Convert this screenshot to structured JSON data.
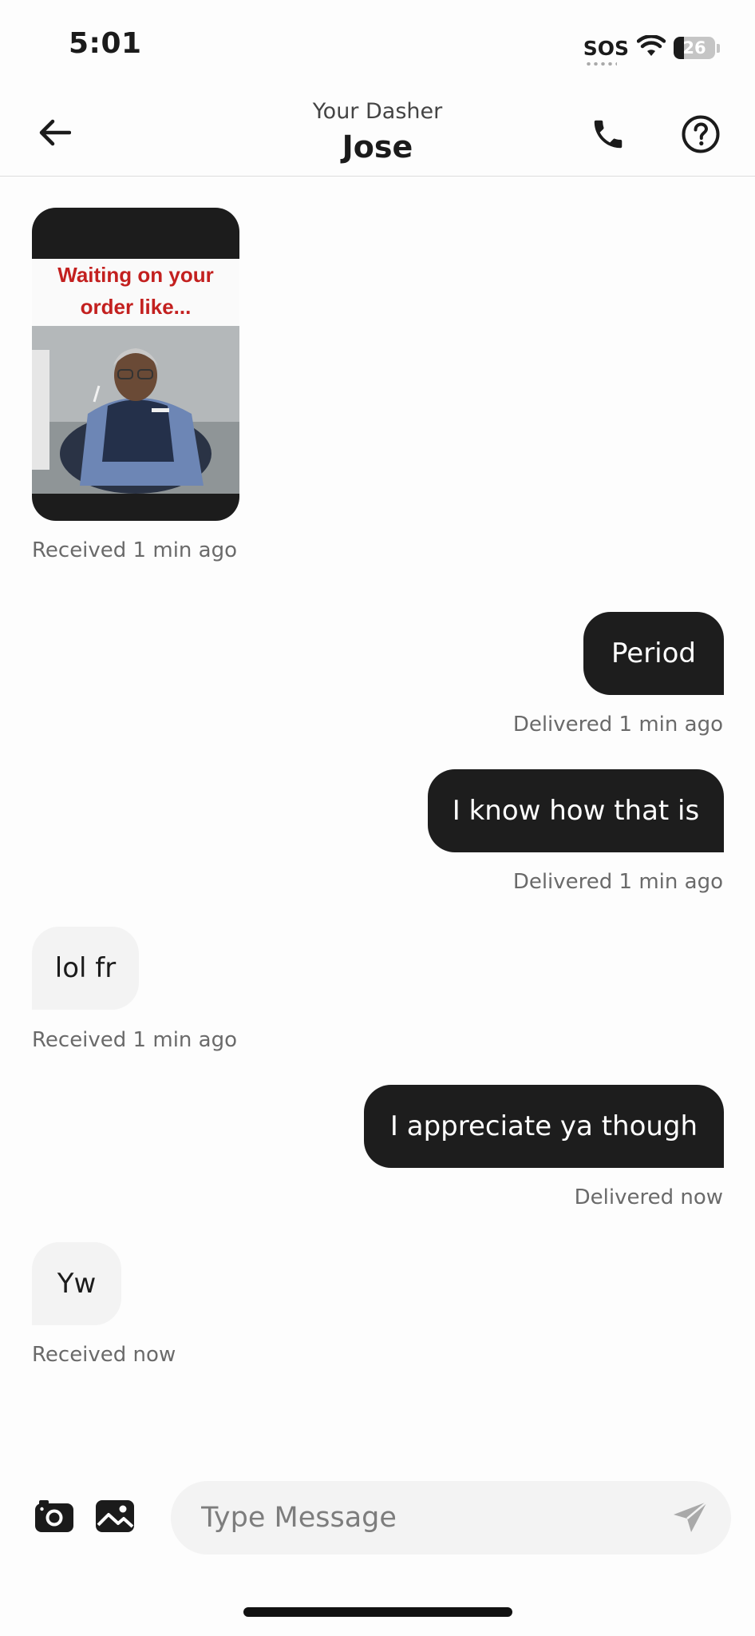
{
  "status_bar": {
    "time": "5:01",
    "sos_label": "SOS",
    "battery_level": "26"
  },
  "header": {
    "subtitle": "Your Dasher",
    "title": "Jose"
  },
  "messages": [
    {
      "type": "image",
      "direction": "received",
      "image_caption": "Waiting on your order like...",
      "status": "Received 1 min ago"
    },
    {
      "type": "text",
      "direction": "sent",
      "text": "Period",
      "status": "Delivered 1 min ago"
    },
    {
      "type": "text",
      "direction": "sent",
      "text": "I know how that is",
      "status": "Delivered 1 min ago"
    },
    {
      "type": "text",
      "direction": "received",
      "text": "lol fr",
      "status": "Received 1 min ago"
    },
    {
      "type": "text",
      "direction": "sent",
      "text": "I appreciate ya though",
      "status": "Delivered now"
    },
    {
      "type": "text",
      "direction": "received",
      "text": "Yw",
      "status": "Received now"
    }
  ],
  "composer": {
    "placeholder": "Type Message",
    "value": ""
  },
  "icons": {
    "back": "arrow-left-icon",
    "call": "phone-icon",
    "help": "question-circle-icon",
    "camera": "camera-icon",
    "gallery": "image-icon",
    "send": "send-icon"
  },
  "colors": {
    "sent_bubble": "#1d1d1d",
    "received_bubble": "#f3f3f3",
    "meme_text": "#c3201f",
    "meta_text": "#6a6a6a"
  }
}
